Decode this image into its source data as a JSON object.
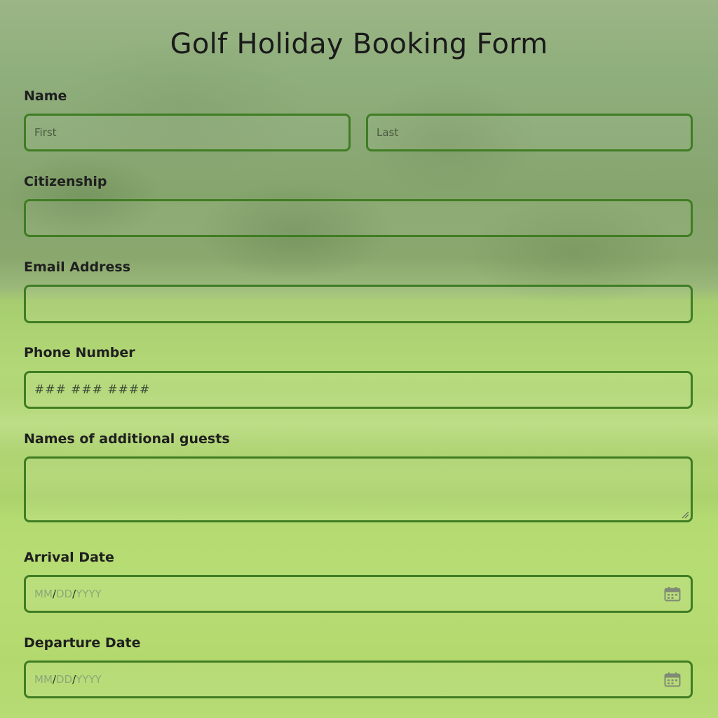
{
  "form": {
    "title": "Golf Holiday Booking Form",
    "name": {
      "label": "Name",
      "first_placeholder": "First",
      "last_placeholder": "Last"
    },
    "citizenship": {
      "label": "Citizenship",
      "value": ""
    },
    "email": {
      "label": "Email Address",
      "value": ""
    },
    "phone": {
      "label": "Phone Number",
      "placeholder": "### ### ####"
    },
    "guests": {
      "label": "Names of additional guests",
      "value": ""
    },
    "arrival": {
      "label": "Arrival Date",
      "mm": "MM",
      "dd": "DD",
      "yyyy": "YYYY",
      "sep": "/",
      "icon": "calendar-icon"
    },
    "departure": {
      "label": "Departure Date",
      "mm": "MM",
      "dd": "DD",
      "yyyy": "YYYY",
      "sep": "/",
      "icon": "calendar-icon"
    }
  },
  "colors": {
    "border": "#3f7d23",
    "date_placeholder": "#8ea777"
  }
}
